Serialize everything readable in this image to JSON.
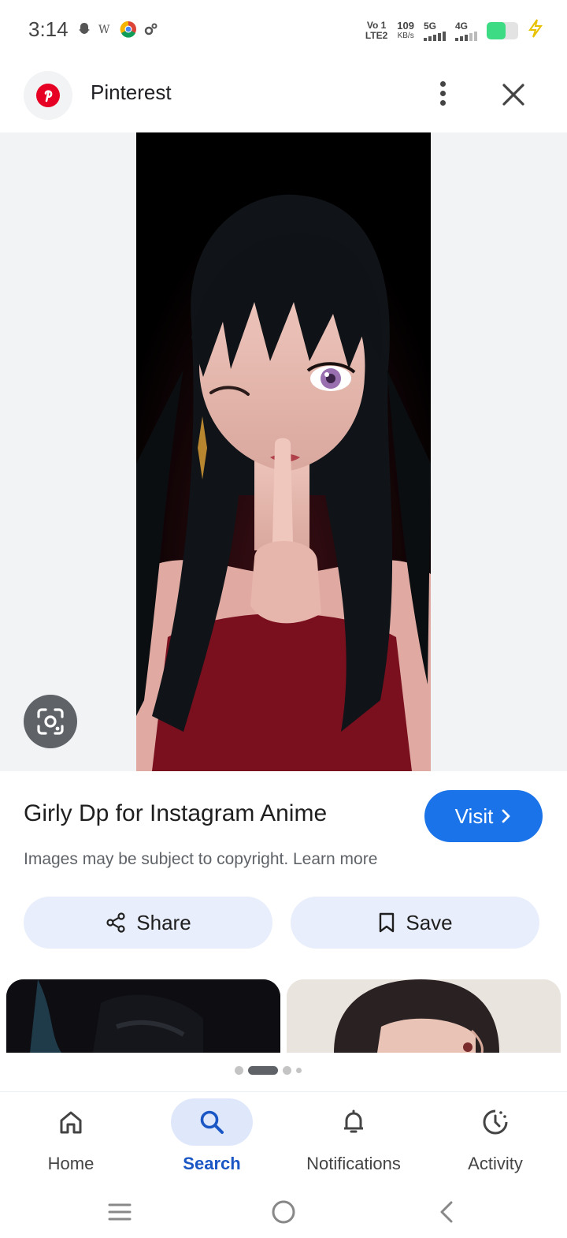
{
  "status_bar": {
    "time": "3:14",
    "net_line1": "Vo 1",
    "net_line2": "LTE2",
    "speed_value": "109",
    "speed_unit": "KB/s",
    "sim1_type": "5G",
    "sim2_type": "4G",
    "battery_level": 0.6,
    "battery_color": "#3ddc84"
  },
  "header": {
    "app_name": "Pinterest",
    "logo_icon": "pinterest-logo-icon",
    "brand_color": "#e60023"
  },
  "result": {
    "title": "Girly Dp for Instagram Anime",
    "copyright_text": "Images may be subject to copyright. Learn more",
    "visit_label": "Visit",
    "share_label": "Share",
    "save_label": "Save",
    "accent_color": "#1a73e8"
  },
  "carousel": {
    "page_count": 4,
    "active_page": 2
  },
  "bottom_nav": {
    "items": [
      {
        "label": "Home",
        "icon": "home-icon"
      },
      {
        "label": "Search",
        "icon": "search-icon"
      },
      {
        "label": "Notifications",
        "icon": "bell-icon"
      },
      {
        "label": "Activity",
        "icon": "activity-icon"
      }
    ],
    "active_index": 1
  }
}
